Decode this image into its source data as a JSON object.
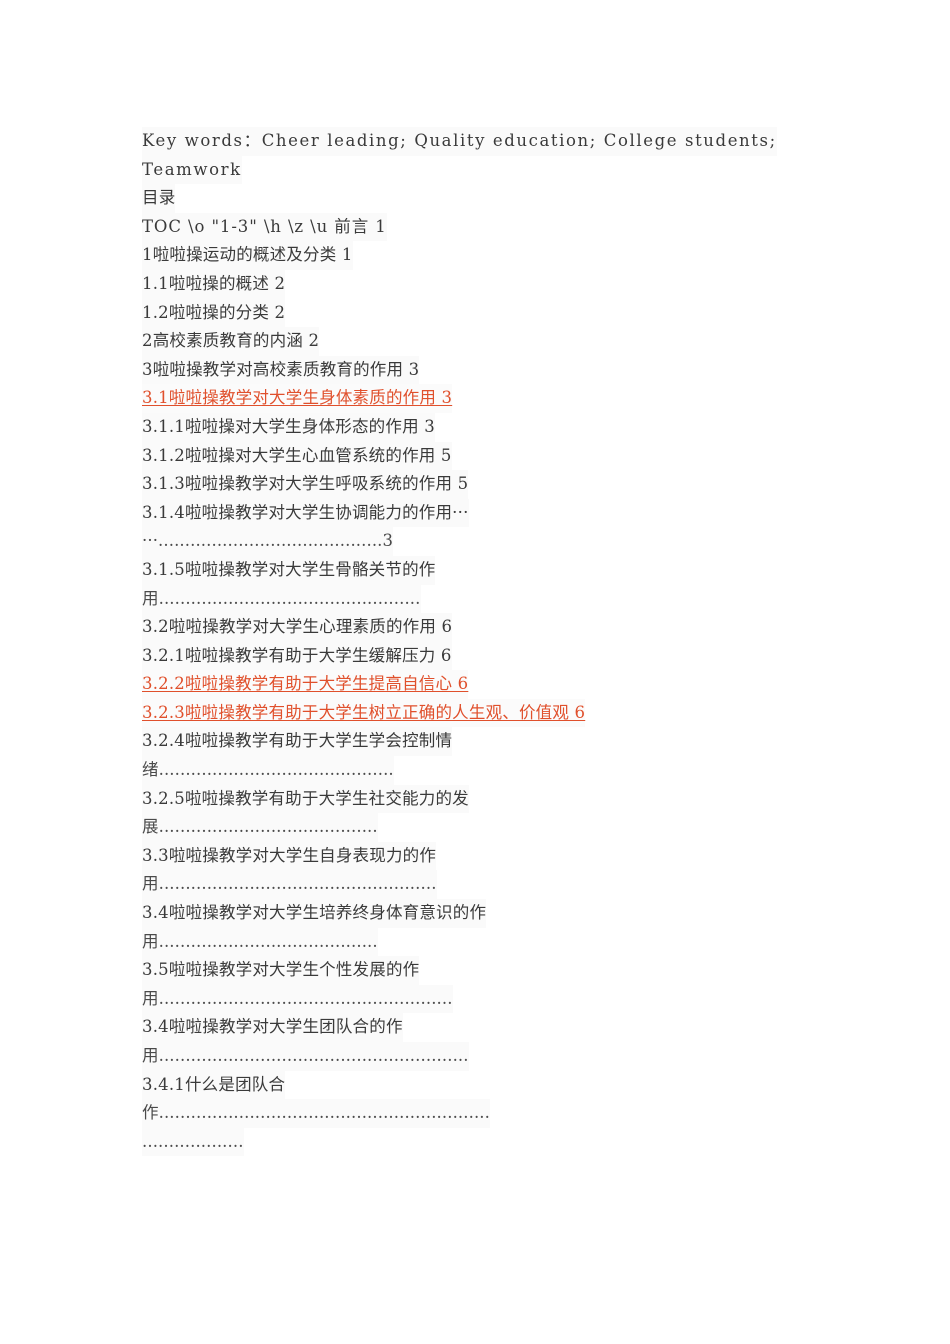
{
  "document": {
    "page_background": "#ffffff",
    "text_color": "#3a3a3a",
    "accent_color": "#e0502c",
    "heading": "目录",
    "keywords_line_1": "Key words：Cheer leading; Quality education; College students;",
    "keywords_line_2": "Teamwork",
    "toc_field_code": "TOC \\o \"1-3\" \\h \\z \\u 前言 1"
  },
  "toc": {
    "entries": [
      {
        "id": "e1",
        "text": "1啦啦操运动的概述及分类 1",
        "style": "plain"
      },
      {
        "id": "e2",
        "text": "1.1啦啦操的概述 2",
        "style": "plain"
      },
      {
        "id": "e3",
        "text": "1.2啦啦操的分类 2",
        "style": "plain"
      },
      {
        "id": "e4",
        "text": "2高校素质教育的内涵 2",
        "style": "plain"
      },
      {
        "id": "e5",
        "text": "3啦啦操教学对高校素质教育的作用 3",
        "style": "plain"
      },
      {
        "id": "e6",
        "text": "3.1啦啦操教学对大学生身体素质的作用 3",
        "style": "red"
      },
      {
        "id": "e7",
        "text": "3.1.1啦啦操对大学生身体形态的作用 3",
        "style": "plain"
      },
      {
        "id": "e8",
        "text": "3.1.2啦啦操对大学生心血管系统的作用 5",
        "style": "plain"
      },
      {
        "id": "e9",
        "text": "3.1.3啦啦操教学对大学生呼吸系统的作用 5",
        "style": "plain"
      },
      {
        "id": "e10",
        "text": "3.1.4啦啦操教学对大学生协调能力的作用···",
        "style": "plain"
      },
      {
        "id": "e11",
        "text": "···..........................................3",
        "style": "leader"
      },
      {
        "id": "e12",
        "text": "3.1.5啦啦操教学对大学生骨骼关节的作",
        "style": "plain"
      },
      {
        "id": "e13",
        "text": "用.................................................",
        "style": "leader"
      },
      {
        "id": "e14",
        "text": "3.2啦啦操教学对大学生心理素质的作用 6",
        "style": "plain"
      },
      {
        "id": "e15",
        "text": "3.2.1啦啦操教学有助于大学生缓解压力 6",
        "style": "plain"
      },
      {
        "id": "e16",
        "text": "3.2.2啦啦操教学有助于大学生提高自信心 6",
        "style": "red"
      },
      {
        "id": "e17",
        "text": "3.2.3啦啦操教学有助于大学生树立正确的人生观、价值观 6",
        "style": "red"
      },
      {
        "id": "e18",
        "text": "3.2.4啦啦操教学有助于大学生学会控制情",
        "style": "plain"
      },
      {
        "id": "e19",
        "text": "绪............................................",
        "style": "leader"
      },
      {
        "id": "e20",
        "text": "3.2.5啦啦操教学有助于大学生社交能力的发",
        "style": "plain"
      },
      {
        "id": "e21",
        "text": "展.........................................",
        "style": "leader"
      },
      {
        "id": "e22",
        "text": "3.3啦啦操教学对大学生自身表现力的作",
        "style": "plain"
      },
      {
        "id": "e23",
        "text": "用....................................................",
        "style": "leader"
      },
      {
        "id": "e24",
        "text": "3.4啦啦操教学对大学生培养终身体育意识的作",
        "style": "plain"
      },
      {
        "id": "e25",
        "text": "用.........................................",
        "style": "leader"
      },
      {
        "id": "e26",
        "text": "3.5啦啦操教学对大学生个性发展的作",
        "style": "plain"
      },
      {
        "id": "e27",
        "text": "用.......................................................",
        "style": "leader"
      },
      {
        "id": "e28",
        "text": "3.4啦啦操教学对大学生团队合的作",
        "style": "plain"
      },
      {
        "id": "e29",
        "text": "用..........................................................",
        "style": "leader"
      },
      {
        "id": "e30",
        "text": "3.4.1什么是团队合",
        "style": "plain"
      },
      {
        "id": "e31",
        "text": "作..............................................................",
        "style": "leader"
      },
      {
        "id": "e32",
        "text": "...................",
        "style": "leader"
      }
    ]
  }
}
